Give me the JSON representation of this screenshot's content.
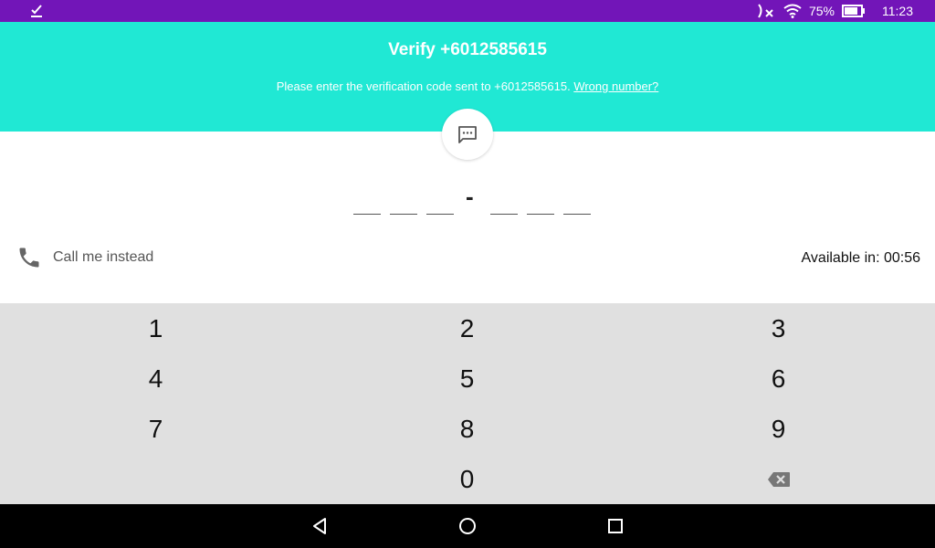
{
  "status_bar": {
    "battery": "75%",
    "time": "11:23",
    "icons": [
      "check-icon",
      "nfc-off-icon",
      "wifi-icon",
      "battery-icon"
    ]
  },
  "header": {
    "title": "Verify +6012585615",
    "subtitle": "Please enter the verification code sent to +6012585615.",
    "wrong_number_link": "Wrong number?"
  },
  "code_entry": {
    "separator": "-",
    "digits": [
      "",
      "",
      "",
      "",
      "",
      ""
    ]
  },
  "call_option": {
    "label": "Call me instead",
    "availability": "Available in: 00:56"
  },
  "keypad": {
    "keys": [
      "1",
      "2",
      "3",
      "4",
      "5",
      "6",
      "7",
      "8",
      "9",
      "0"
    ],
    "backspace_icon": "backspace-icon"
  },
  "nav_bar": {
    "icons": [
      "back-icon",
      "home-icon",
      "recents-icon"
    ]
  },
  "colors": {
    "status_bar": "#7215b8",
    "header": "#20e8d4",
    "keypad_bg": "#e0e0e0",
    "nav_bar": "#000000"
  }
}
